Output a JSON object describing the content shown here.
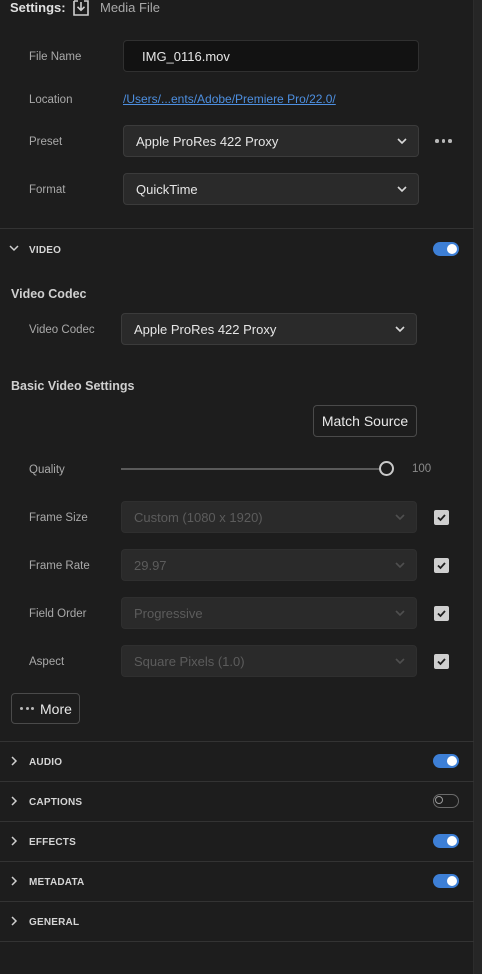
{
  "header": {
    "title": "Settings:",
    "destination_label": "Media File"
  },
  "output": {
    "file_name_label": "File Name",
    "file_name_value": "IMG_0116.mov",
    "location_label": "Location",
    "location_value": "/Users/...ents/Adobe/Premiere Pro/22.0/",
    "preset_label": "Preset",
    "preset_value": "Apple ProRes 422 Proxy",
    "format_label": "Format",
    "format_value": "QuickTime"
  },
  "video": {
    "section_label": "VIDEO",
    "enabled": true,
    "codec_heading": "Video Codec",
    "codec_label": "Video Codec",
    "codec_value": "Apple ProRes 422 Proxy",
    "basic_heading": "Basic Video Settings",
    "match_source_label": "Match Source",
    "quality_label": "Quality",
    "quality_value": "100",
    "frame_size_label": "Frame Size",
    "frame_size_value": "Custom (1080 x 1920)",
    "frame_rate_label": "Frame Rate",
    "frame_rate_value": "29.97",
    "field_order_label": "Field Order",
    "field_order_value": "Progressive",
    "aspect_label": "Aspect",
    "aspect_value": "Square Pixels (1.0)",
    "more_label": "More"
  },
  "sections": [
    {
      "label": "AUDIO",
      "enabled": true
    },
    {
      "label": "CAPTIONS",
      "enabled": false
    },
    {
      "label": "EFFECTS",
      "enabled": true
    },
    {
      "label": "METADATA",
      "enabled": true
    },
    {
      "label": "GENERAL"
    }
  ],
  "colors": {
    "accent": "#3d7fd6",
    "link": "#4d8fe0",
    "background": "#1d1d1d"
  }
}
